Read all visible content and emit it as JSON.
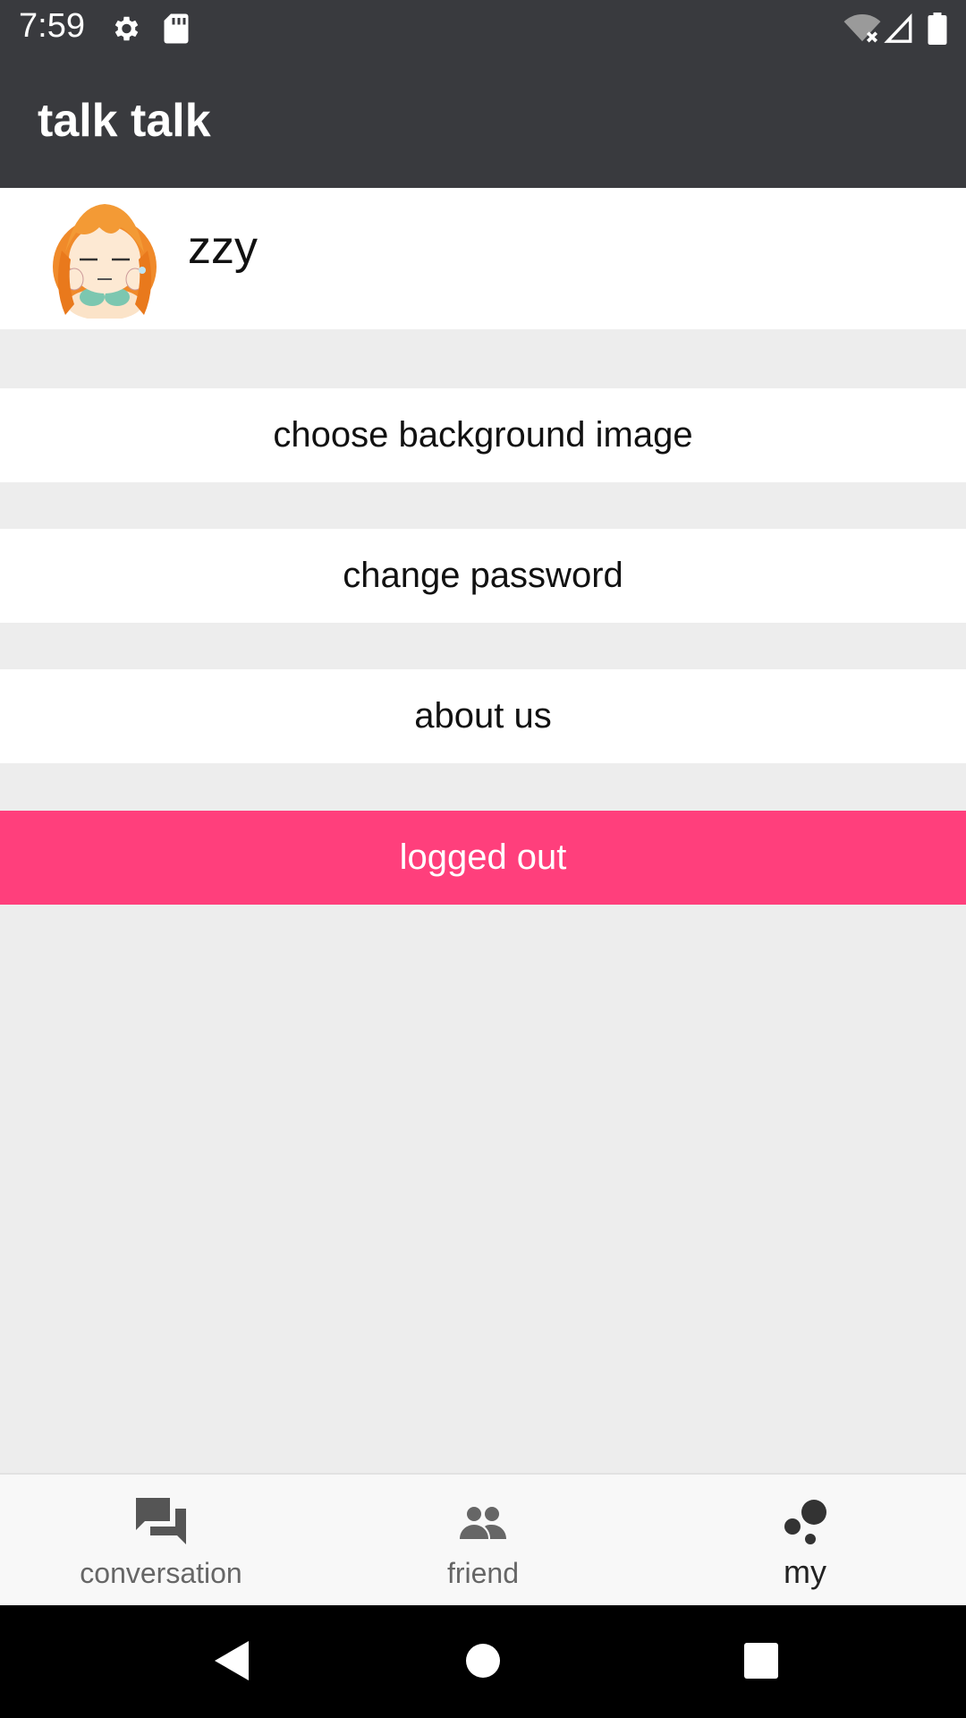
{
  "status_bar": {
    "time": "7:59",
    "icons": [
      "gear-icon",
      "sd-card-icon",
      "wifi-off-icon",
      "signal-icon",
      "battery-icon"
    ]
  },
  "app_bar": {
    "title": "talk talk"
  },
  "profile": {
    "name": "zzy"
  },
  "menu": {
    "choose_background": "choose background image",
    "change_password": "change password",
    "about_us": "about us",
    "logout": "logged out"
  },
  "tabs": [
    {
      "label": "conversation",
      "icon": "chat-icon"
    },
    {
      "label": "friend",
      "icon": "people-icon"
    },
    {
      "label": "my",
      "icon": "dots-icon",
      "active": true
    }
  ],
  "colors": {
    "header": "#393a3e",
    "logout_accent": "#ff3f7c",
    "background": "#ededed"
  }
}
